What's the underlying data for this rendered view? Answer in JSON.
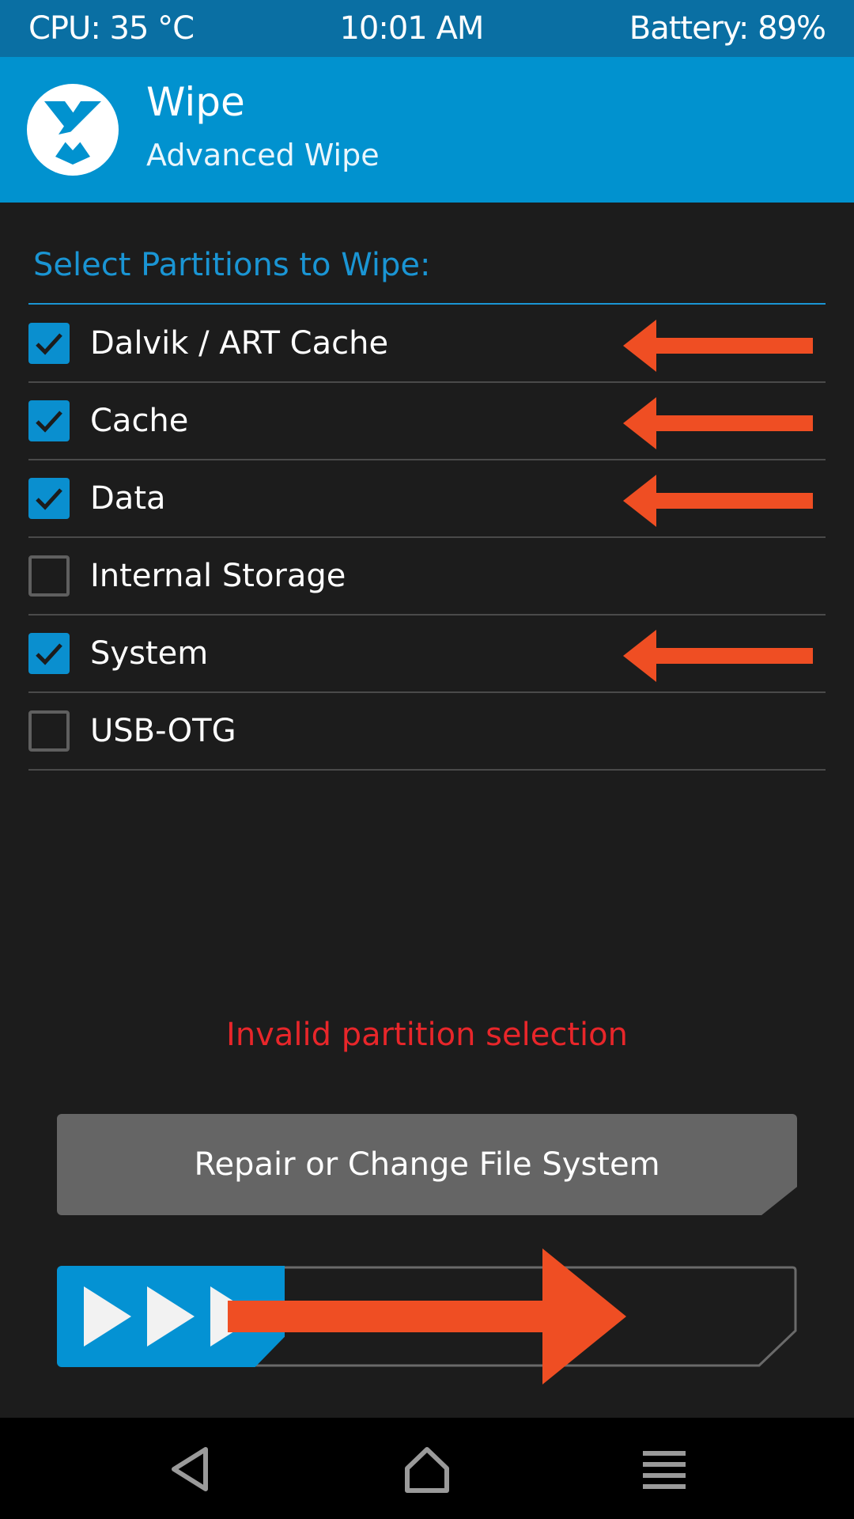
{
  "status_bar": {
    "cpu": "CPU: 35 °C",
    "time": "10:01 AM",
    "battery": "Battery: 89%"
  },
  "header": {
    "title": "Wipe",
    "subtitle": "Advanced Wipe",
    "logo_icon": "twrp-logo-icon"
  },
  "section": {
    "label": "Select Partitions to Wipe:"
  },
  "partitions": [
    {
      "label": "Dalvik / ART Cache",
      "checked": true,
      "annotated": true
    },
    {
      "label": "Cache",
      "checked": true,
      "annotated": true
    },
    {
      "label": "Data",
      "checked": true,
      "annotated": true
    },
    {
      "label": "Internal Storage",
      "checked": false,
      "annotated": false
    },
    {
      "label": "System",
      "checked": true,
      "annotated": true
    },
    {
      "label": "USB-OTG",
      "checked": false,
      "annotated": false
    }
  ],
  "error_message": "Invalid partition selection",
  "repair_button": {
    "label": "Repair or Change File System"
  },
  "swipe_slider": {
    "label": "",
    "icon": "triple-chevron-right-icon"
  },
  "navigation": {
    "back_icon": "back-triangle-icon",
    "home_icon": "home-icon",
    "menu_icon": "menu-icon"
  },
  "colors": {
    "status_bar": "#0a6fa3",
    "header": "#0192cf",
    "accent": "#1a95d4",
    "background": "#1c1c1c",
    "error": "#e8262a",
    "annotation_arrow": "#ef4e23",
    "button_gray": "#656565"
  }
}
